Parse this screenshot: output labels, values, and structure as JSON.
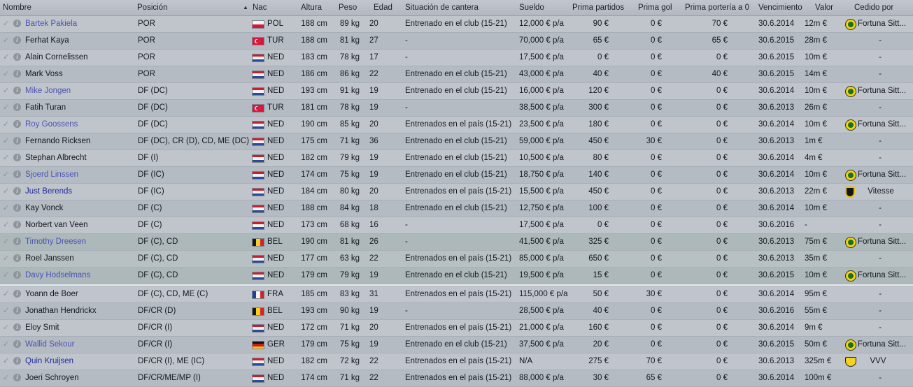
{
  "columns": {
    "nombre": "Nombre",
    "posicion": "Posición",
    "nac": "Nac",
    "altura": "Altura",
    "peso": "Peso",
    "edad": "Edad",
    "cantera": "Situación de cantera",
    "sueldo": "Sueldo",
    "prima_partidos": "Prima partidos",
    "prima_gol": "Prima gol",
    "prima_porteria": "Prima portería a 0",
    "vencimiento": "Vencimiento",
    "valor": "Valor",
    "cedido": "Cedido por"
  },
  "sort": {
    "column": "posicion",
    "direction": "ascending",
    "arrow": "▲"
  },
  "icons": {
    "row_tick": "tick-icon",
    "row_info": "info-icon"
  },
  "colors": {
    "loan_name": "#4a53b5",
    "highlight_row": "#b7c0c2",
    "separator": "#e8ebee"
  },
  "players": [
    {
      "name": "Bartek Pakiela",
      "pos": "POR",
      "nat": "POL",
      "height": "188 cm",
      "weight": "89 kg",
      "age": "20",
      "youth": "Entrenado en el club (15-21)",
      "wage": "12,000 € p/a",
      "appearance": "90 €",
      "goal": "0 €",
      "clean": "70 €",
      "expiry": "30.6.2014",
      "value": "12m €",
      "loan": "Fortuna Sitt...",
      "loan_crest": "fortuna-crest",
      "link": "loan"
    },
    {
      "name": "Ferhat Kaya",
      "pos": "POR",
      "nat": "TUR",
      "height": "188 cm",
      "weight": "81 kg",
      "age": "27",
      "youth": "-",
      "wage": "70,000 € p/a",
      "appearance": "65 €",
      "goal": "0 €",
      "clean": "65 €",
      "expiry": "30.6.2015",
      "value": "28m €",
      "loan": "-",
      "loan_crest": "",
      "link": ""
    },
    {
      "name": "Alain Cornelissen",
      "pos": "POR",
      "nat": "NED",
      "height": "183 cm",
      "weight": "78 kg",
      "age": "17",
      "youth": "-",
      "wage": "17,500 € p/a",
      "appearance": "0 €",
      "goal": "0 €",
      "clean": "0 €",
      "expiry": "30.6.2015",
      "value": "10m €",
      "loan": "-",
      "loan_crest": "",
      "link": ""
    },
    {
      "name": "Mark Voss",
      "pos": "POR",
      "nat": "NED",
      "height": "186 cm",
      "weight": "86 kg",
      "age": "22",
      "youth": "Entrenado en el club (15-21)",
      "wage": "43,000 € p/a",
      "appearance": "40 €",
      "goal": "0 €",
      "clean": "40 €",
      "expiry": "30.6.2015",
      "value": "14m €",
      "loan": "-",
      "loan_crest": "",
      "link": ""
    },
    {
      "name": "Mike Jongen",
      "pos": "DF (DC)",
      "nat": "NED",
      "height": "193 cm",
      "weight": "91 kg",
      "age": "19",
      "youth": "Entrenado en el club (15-21)",
      "wage": "16,000 € p/a",
      "appearance": "120 €",
      "goal": "0 €",
      "clean": "0 €",
      "expiry": "30.6.2014",
      "value": "10m €",
      "loan": "Fortuna Sitt...",
      "loan_crest": "fortuna-crest",
      "link": "loan"
    },
    {
      "name": "Fatih Turan",
      "pos": "DF (DC)",
      "nat": "TUR",
      "height": "181 cm",
      "weight": "78 kg",
      "age": "19",
      "youth": "-",
      "wage": "38,500 € p/a",
      "appearance": "300 €",
      "goal": "0 €",
      "clean": "0 €",
      "expiry": "30.6.2013",
      "value": "26m €",
      "loan": "-",
      "loan_crest": "",
      "link": ""
    },
    {
      "name": "Roy Goossens",
      "pos": "DF (DC)",
      "nat": "NED",
      "height": "190 cm",
      "weight": "85 kg",
      "age": "20",
      "youth": "Entrenados en el país (15-21)",
      "wage": "23,500 € p/a",
      "appearance": "180 €",
      "goal": "0 €",
      "clean": "0 €",
      "expiry": "30.6.2014",
      "value": "10m €",
      "loan": "Fortuna Sitt...",
      "loan_crest": "fortuna-crest",
      "link": "loan"
    },
    {
      "name": "Fernando Ricksen",
      "pos": "DF (DC), CR (D), CD, ME (DC)",
      "nat": "NED",
      "height": "175 cm",
      "weight": "71 kg",
      "age": "36",
      "youth": "Entrenado en el club (15-21)",
      "wage": "59,000 € p/a",
      "appearance": "450 €",
      "goal": "30 €",
      "clean": "0 €",
      "expiry": "30.6.2013",
      "value": "1m €",
      "loan": "-",
      "loan_crest": "",
      "link": ""
    },
    {
      "name": "Stephan Albrecht",
      "pos": "DF (I)",
      "nat": "NED",
      "height": "182 cm",
      "weight": "79 kg",
      "age": "19",
      "youth": "Entrenado en el club (15-21)",
      "wage": "10,500 € p/a",
      "appearance": "80 €",
      "goal": "0 €",
      "clean": "0 €",
      "expiry": "30.6.2014",
      "value": "4m €",
      "loan": "-",
      "loan_crest": "",
      "link": ""
    },
    {
      "name": "Sjoerd Linssen",
      "pos": "DF (IC)",
      "nat": "NED",
      "height": "174 cm",
      "weight": "75 kg",
      "age": "19",
      "youth": "Entrenado en el club (15-21)",
      "wage": "18,750 € p/a",
      "appearance": "140 €",
      "goal": "0 €",
      "clean": "0 €",
      "expiry": "30.6.2014",
      "value": "10m €",
      "loan": "Fortuna Sitt...",
      "loan_crest": "fortuna-crest",
      "link": "loan"
    },
    {
      "name": "Just Berends",
      "pos": "DF (IC)",
      "nat": "NED",
      "height": "184 cm",
      "weight": "80 kg",
      "age": "20",
      "youth": "Entrenados en el país (15-21)",
      "wage": "15,500 € p/a",
      "appearance": "450 €",
      "goal": "0 €",
      "clean": "0 €",
      "expiry": "30.6.2013",
      "value": "22m €",
      "loan": "Vitesse",
      "loan_crest": "vitesse-crest",
      "link": "dark"
    },
    {
      "name": "Kay Vonck",
      "pos": "DF (C)",
      "nat": "NED",
      "height": "188 cm",
      "weight": "84 kg",
      "age": "18",
      "youth": "Entrenado en el club (15-21)",
      "wage": "12,750 € p/a",
      "appearance": "100 €",
      "goal": "0 €",
      "clean": "0 €",
      "expiry": "30.6.2014",
      "value": "10m €",
      "loan": "-",
      "loan_crest": "",
      "link": ""
    },
    {
      "name": "Norbert van Veen",
      "pos": "DF (C)",
      "nat": "NED",
      "height": "173 cm",
      "weight": "68 kg",
      "age": "16",
      "youth": "-",
      "wage": "17,500 € p/a",
      "appearance": "0 €",
      "goal": "0 €",
      "clean": "0 €",
      "expiry": "30.6.2016",
      "value": "-",
      "loan": "-",
      "loan_crest": "",
      "link": ""
    },
    {
      "name": "Timothy Dreesen",
      "pos": "DF (C), CD",
      "nat": "BEL",
      "height": "190 cm",
      "weight": "81 kg",
      "age": "26",
      "youth": "-",
      "wage": "41,500 € p/a",
      "appearance": "325 €",
      "goal": "0 €",
      "clean": "0 €",
      "expiry": "30.6.2013",
      "value": "75m €",
      "loan": "Fortuna Sitt...",
      "loan_crest": "fortuna-crest",
      "link": "loan"
    },
    {
      "name": "Roel Janssen",
      "pos": "DF (C), CD",
      "nat": "NED",
      "height": "177 cm",
      "weight": "63 kg",
      "age": "22",
      "youth": "Entrenados en el país (15-21)",
      "wage": "85,000 € p/a",
      "appearance": "650 €",
      "goal": "0 €",
      "clean": "0 €",
      "expiry": "30.6.2013",
      "value": "35m €",
      "loan": "-",
      "loan_crest": "",
      "link": ""
    },
    {
      "name": "Davy Hodselmans",
      "pos": "DF (C), CD",
      "nat": "NED",
      "height": "179 cm",
      "weight": "79 kg",
      "age": "19",
      "youth": "Entrenado en el club (15-21)",
      "wage": "19,500 € p/a",
      "appearance": "15 €",
      "goal": "0 €",
      "clean": "0 €",
      "expiry": "30.6.2015",
      "value": "10m €",
      "loan": "Fortuna Sitt...",
      "loan_crest": "fortuna-crest",
      "link": "loan"
    },
    {
      "name": "Yoann de Boer",
      "pos": "DF (C), CD, ME (C)",
      "nat": "FRA",
      "height": "185 cm",
      "weight": "83 kg",
      "age": "31",
      "youth": "Entrenados en el país (15-21)",
      "wage": "115,000 € p/a",
      "appearance": "50 €",
      "goal": "30 €",
      "clean": "0 €",
      "expiry": "30.6.2014",
      "value": "95m €",
      "loan": "-",
      "loan_crest": "",
      "link": ""
    },
    {
      "name": "Jonathan Hendrickx",
      "pos": "DF/CR (D)",
      "nat": "BEL",
      "height": "193 cm",
      "weight": "90 kg",
      "age": "19",
      "youth": "-",
      "wage": "28,500 € p/a",
      "appearance": "40 €",
      "goal": "0 €",
      "clean": "0 €",
      "expiry": "30.6.2016",
      "value": "55m €",
      "loan": "-",
      "loan_crest": "",
      "link": ""
    },
    {
      "name": "Eloy Smit",
      "pos": "DF/CR (I)",
      "nat": "NED",
      "height": "172 cm",
      "weight": "71 kg",
      "age": "20",
      "youth": "Entrenados en el país (15-21)",
      "wage": "21,000 € p/a",
      "appearance": "160 €",
      "goal": "0 €",
      "clean": "0 €",
      "expiry": "30.6.2014",
      "value": "9m €",
      "loan": "-",
      "loan_crest": "",
      "link": ""
    },
    {
      "name": "Wallid Sekour",
      "pos": "DF/CR (I)",
      "nat": "GER",
      "height": "179 cm",
      "weight": "75 kg",
      "age": "19",
      "youth": "Entrenado en el club (15-21)",
      "wage": "37,500 € p/a",
      "appearance": "20 €",
      "goal": "0 €",
      "clean": "0 €",
      "expiry": "30.6.2015",
      "value": "50m €",
      "loan": "Fortuna Sitt...",
      "loan_crest": "fortuna-crest",
      "link": "loan"
    },
    {
      "name": "Quin Kruijsen",
      "pos": "DF/CR (I), ME (IC)",
      "nat": "NED",
      "height": "182 cm",
      "weight": "72 kg",
      "age": "22",
      "youth": "Entrenados en el país (15-21)",
      "wage": "N/A",
      "appearance": "275 €",
      "goal": "70 €",
      "clean": "0 €",
      "expiry": "30.6.2013",
      "value": "325m €",
      "loan": "VVV",
      "loan_crest": "vvv-crest",
      "link": "dark"
    },
    {
      "name": "Joeri Schroyen",
      "pos": "DF/CR/ME/MP (I)",
      "nat": "NED",
      "height": "174 cm",
      "weight": "71 kg",
      "age": "22",
      "youth": "Entrenados en el país (15-21)",
      "wage": "88,000 € p/a",
      "appearance": "30 €",
      "goal": "65 €",
      "clean": "0 €",
      "expiry": "30.6.2014",
      "value": "100m €",
      "loan": "-",
      "loan_crest": "",
      "link": ""
    }
  ]
}
